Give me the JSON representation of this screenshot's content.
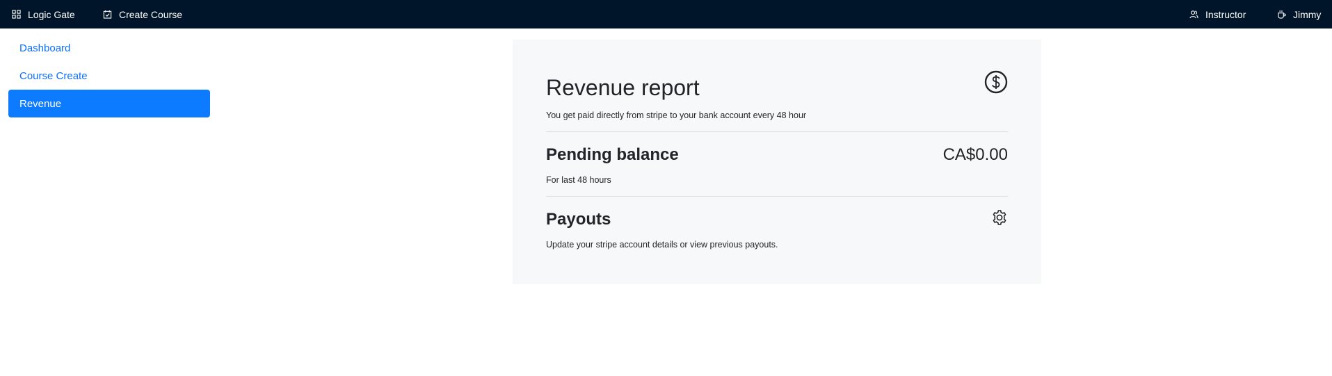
{
  "topbar": {
    "brand_label": "Logic Gate",
    "create_course_label": "Create Course",
    "instructor_label": "Instructor",
    "user_label": "Jimmy"
  },
  "sidebar": {
    "items": [
      {
        "label": "Dashboard",
        "active": false
      },
      {
        "label": "Course Create",
        "active": false
      },
      {
        "label": "Revenue",
        "active": true
      }
    ]
  },
  "revenue": {
    "title": "Revenue report",
    "subtitle": "You get paid directly from stripe to your bank account every 48 hour",
    "pending": {
      "title": "Pending balance",
      "amount": "CA$0.00",
      "note": "For last 48 hours"
    },
    "payouts": {
      "title": "Payouts",
      "note": "Update your stripe account details or view previous payouts."
    }
  },
  "icons": {
    "brand": "apps-icon",
    "create_course": "calendar-check-icon",
    "instructor": "team-icon",
    "user": "coffee-icon",
    "revenue": "dollar-circle-icon",
    "payouts": "gear-icon"
  },
  "colors": {
    "topbar_bg": "#001529",
    "accent": "#0d7bff",
    "card_bg": "#f7f8f9"
  }
}
